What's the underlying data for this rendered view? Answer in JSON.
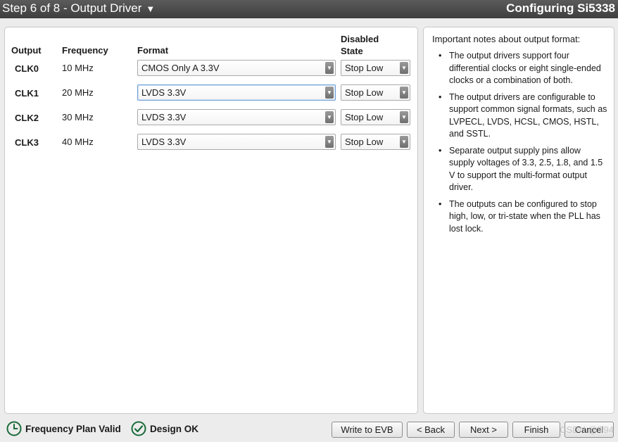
{
  "titlebar": {
    "step_label": "Step 6 of 8 - Output Driver",
    "app_title": "Configuring Si5338"
  },
  "table": {
    "headers": {
      "output": "Output",
      "frequency": "Frequency",
      "format": "Format",
      "disabled_state_line1": "Disabled",
      "disabled_state_line2": "State"
    },
    "rows": [
      {
        "clock": "CLK0",
        "frequency": "10 MHz",
        "format": "CMOS Only A 3.3V",
        "disabled_state": "Stop Low"
      },
      {
        "clock": "CLK1",
        "frequency": "20 MHz",
        "format": "LVDS 3.3V",
        "disabled_state": "Stop Low"
      },
      {
        "clock": "CLK2",
        "frequency": "30 MHz",
        "format": "LVDS 3.3V",
        "disabled_state": "Stop Low"
      },
      {
        "clock": "CLK3",
        "frequency": "40 MHz",
        "format": "LVDS 3.3V",
        "disabled_state": "Stop Low"
      }
    ]
  },
  "notes": {
    "title": "Important notes about output format:",
    "items": [
      "The output drivers support four differential clocks or eight single-ended clocks or a combination of both.",
      "The output drivers are configurable to support common signal formats, such as LVPECL, LVDS, HCSL, CMOS, HSTL, and SSTL.",
      "Separate output supply pins allow supply voltages of 3.3, 2.5, 1.8, and 1.5 V to support the multi-format output driver.",
      "The outputs can be configured to stop high, low, or tri-state when the PLL has lost lock."
    ]
  },
  "status": {
    "frequency_plan": "Frequency Plan Valid",
    "design": "Design OK",
    "color": "#1a6b3a"
  },
  "buttons": {
    "write_evb": "Write to EVB",
    "back": "< Back",
    "next": "Next >",
    "finish": "Finish",
    "cancel": "Cancel"
  },
  "watermark": "CSDN @lll94",
  "icons": {
    "step_dropdown": "triangle-down-icon",
    "select_arrow": "chevron-down-icon",
    "frequency_plan": "clock-icon",
    "design": "check-circle-icon"
  }
}
